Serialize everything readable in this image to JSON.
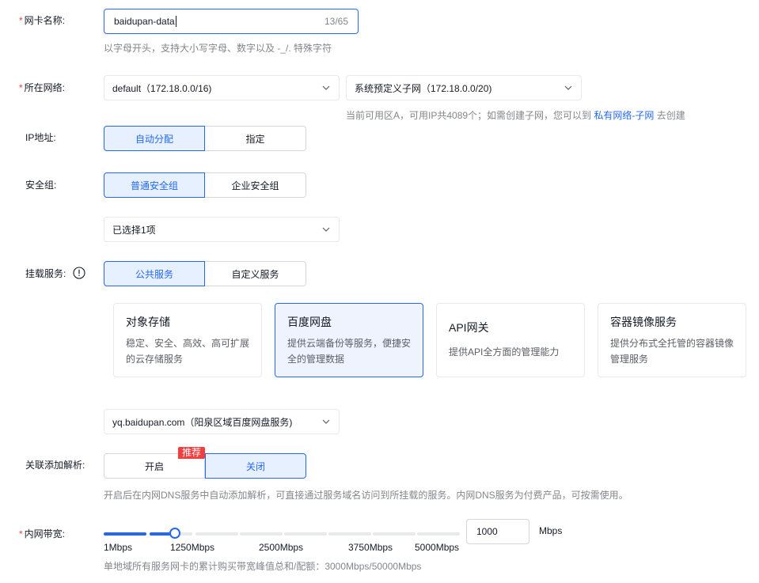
{
  "nic_name": {
    "label": "网卡名称:",
    "value": "baidupan-data",
    "counter": "13/65",
    "hint": "以字母开头，支持大小写字母、数字以及 -_/. 特殊字符"
  },
  "network": {
    "label": "所在网络:",
    "vpc_value": "default（172.18.0.0/16)",
    "subnet_value": "系统预定义子网（172.18.0.0/20)",
    "hint_prefix": "当前可用区A，可用IP共4089个；如需创建子网，您可以到",
    "hint_link": "私有网络-子网",
    "hint_suffix": "去创建"
  },
  "ip_address": {
    "label": "IP地址:",
    "options": [
      "自动分配",
      "指定"
    ],
    "selected": "自动分配"
  },
  "security_group": {
    "label": "安全组:",
    "options": [
      "普通安全组",
      "企业安全组"
    ],
    "selected": "普通安全组",
    "select_value": "已选择1项"
  },
  "mount_service": {
    "label": "挂载服务:",
    "options": [
      "公共服务",
      "自定义服务"
    ],
    "selected": "公共服务",
    "cards": [
      {
        "title": "对象存储",
        "desc": "稳定、安全、高效、高可扩展的云存储服务"
      },
      {
        "title": "百度网盘",
        "desc": "提供云端备份等服务，便捷安全的管理数据"
      },
      {
        "title": "API网关",
        "desc": "提供API全方面的管理能力"
      },
      {
        "title": "容器镜像服务",
        "desc": "提供分布式全托管的容器镜像管理服务"
      }
    ],
    "selected_card": "百度网盘",
    "endpoint_value": "yq.baidupan.com（阳泉区域百度网盘服务)"
  },
  "dns": {
    "label": "关联添加解析:",
    "options": [
      "开启",
      "关闭"
    ],
    "selected": "关闭",
    "badge": "推荐",
    "hint": "开启后在内网DNS服务中自动添加解析，可直接通过服务域名访问到所挂载的服务。内网DNS服务为付费产品，可按需使用。"
  },
  "bandwidth": {
    "label": "内网带宽:",
    "ticks": [
      "1Mbps",
      "1250Mbps",
      "2500Mbps",
      "3750Mbps",
      "5000Mbps"
    ],
    "value": "1000",
    "unit": "Mbps",
    "slider_min": 1,
    "slider_max": 5000,
    "slider_value": 1000,
    "hint": "单地域所有服务网卡的累计购买带宽峰值总和/配额：3000Mbps/50000Mbps"
  },
  "colors": {
    "primary": "#2468f2",
    "required": "#f33e3e",
    "border": "#d4d6d9",
    "hint": "#84868c"
  }
}
